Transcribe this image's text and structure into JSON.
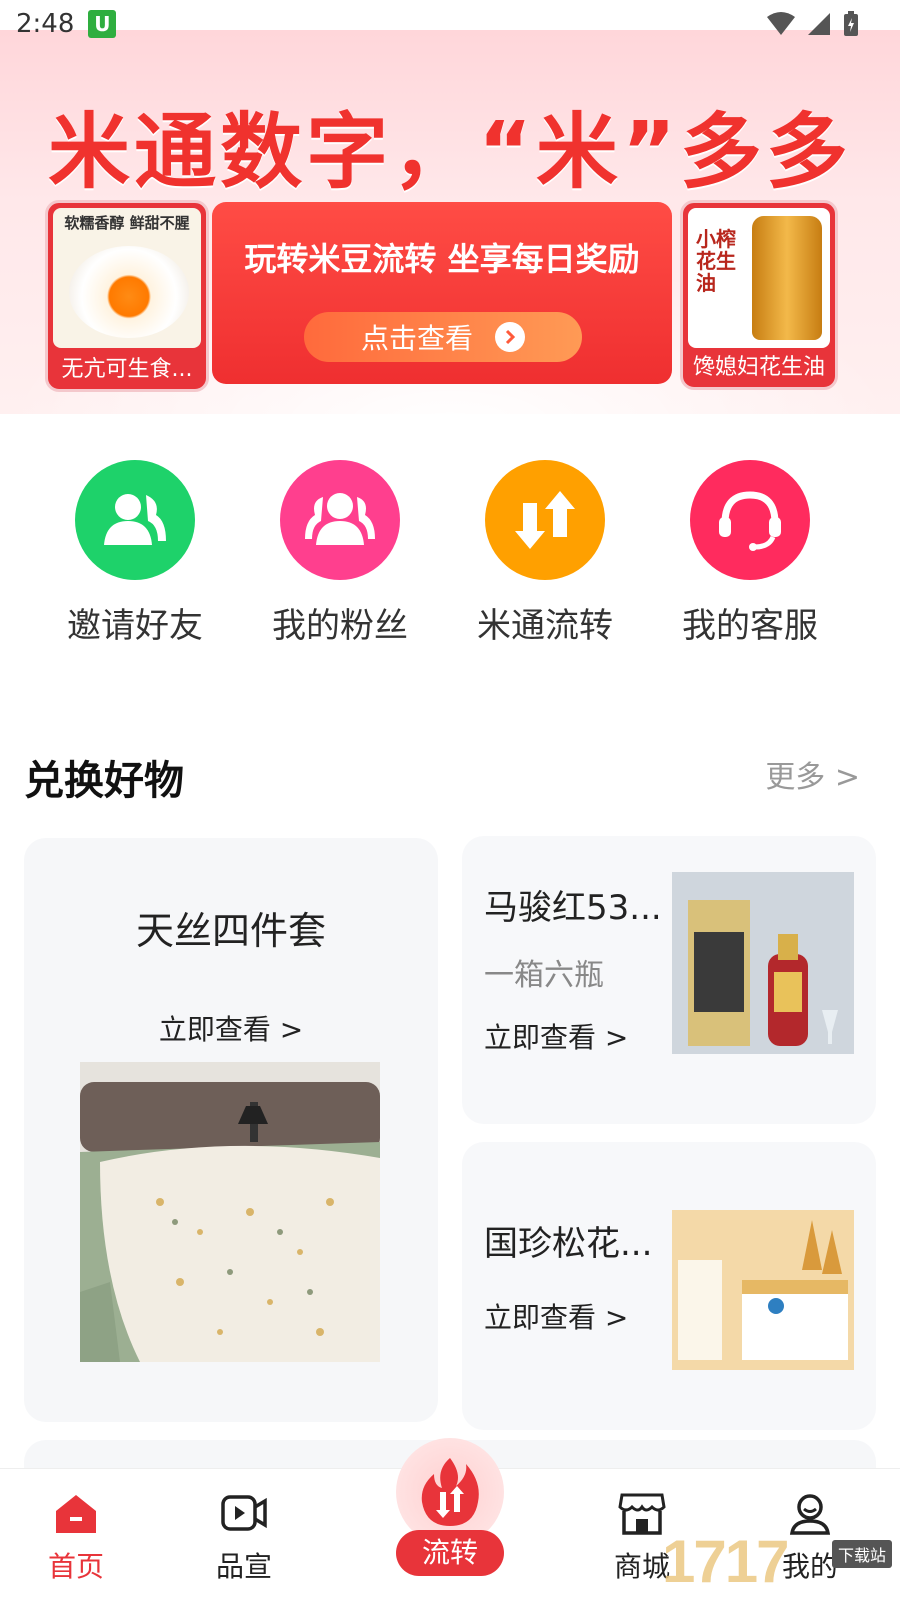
{
  "status_bar": {
    "time": "2:48",
    "app_badge": "U"
  },
  "hero": {
    "title": "米通数字，“米”多多",
    "left_card": {
      "headline": "软糯香醇 鲜甜不腥",
      "caption": "无亢可生食..."
    },
    "center_card": {
      "promo_text": "玩转米豆流转 坐享每日奖励",
      "cta_label": "点击查看"
    },
    "right_card": {
      "caption": "馋媳妇花生油",
      "bottle_text": "小榨花生油"
    }
  },
  "quick_actions": [
    {
      "label": "邀请好友",
      "color": "#1ed26a",
      "icon": "user-icon"
    },
    {
      "label": "我的粉丝",
      "color": "#ff3f8e",
      "icon": "users-icon"
    },
    {
      "label": "米通流转",
      "color": "#ffa000",
      "icon": "swap-icon"
    },
    {
      "label": "我的客服",
      "color": "#ff2b5e",
      "icon": "headset-icon"
    }
  ],
  "section": {
    "title": "兑换好物",
    "more_label": "更多 >"
  },
  "products": {
    "big": {
      "name": "天丝四件套",
      "view": "立即查看 >"
    },
    "small_1": {
      "name": "马骏红53...",
      "sub": "一箱六瓶",
      "view": "立即查看 >"
    },
    "small_2": {
      "name": "国珍松花...",
      "view": "立即查看 >"
    }
  },
  "bottom_nav": {
    "items": [
      {
        "label": "首页",
        "icon": "home-icon",
        "active": true
      },
      {
        "label": "品宣",
        "icon": "video-icon",
        "active": false
      },
      {
        "label": "商城",
        "icon": "store-icon",
        "active": false
      },
      {
        "label": "我的",
        "icon": "profile-icon",
        "active": false
      }
    ],
    "center": {
      "label": "流转",
      "icon": "fire-swap-icon"
    }
  },
  "watermark": {
    "text": "1717",
    "tag": "下载站"
  },
  "colors": {
    "accent": "#e8343a",
    "green": "#1ed26a",
    "pink": "#ff3f8e",
    "orange": "#ffa000",
    "red": "#ff2b5e"
  }
}
